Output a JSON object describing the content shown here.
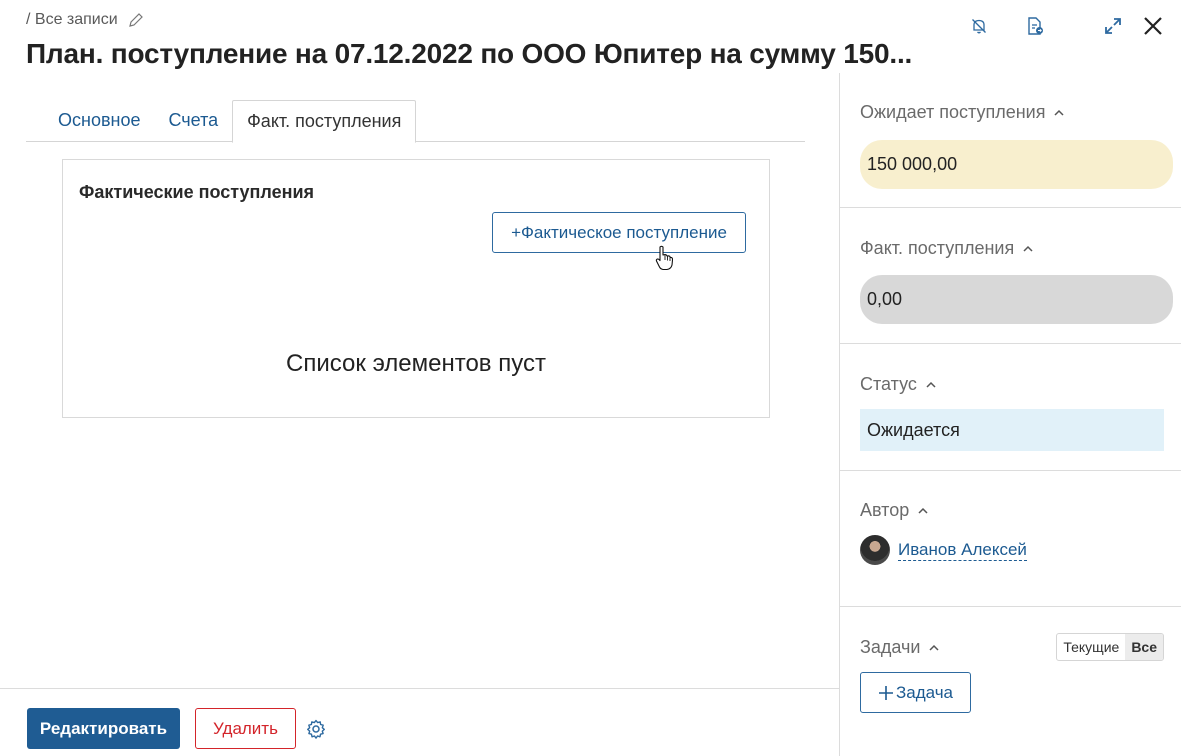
{
  "header": {
    "breadcrumb": "/ Все записи",
    "title": "План. поступление на 07.12.2022 по ООО Юпитер на сумму 150..."
  },
  "tabs": [
    {
      "label": "Основное"
    },
    {
      "label": "Счета"
    },
    {
      "label": "Факт. поступления"
    }
  ],
  "panel": {
    "title": "Фактические поступления",
    "add_button": "+Фактическое поступление",
    "empty_text": "Список элементов пуст"
  },
  "footer": {
    "edit_label": "Редактировать",
    "delete_label": "Удалить"
  },
  "sidebar": {
    "expected": {
      "label": "Ожидает поступления",
      "value": "150 000,00"
    },
    "actual": {
      "label": "Факт. поступления",
      "value": "0,00"
    },
    "status": {
      "label": "Статус",
      "value": "Ожидается"
    },
    "author": {
      "label": "Автор",
      "name": "Иванов Алексей"
    },
    "tasks": {
      "label": "Задачи",
      "toggle_current": "Текущие",
      "toggle_all": "Все",
      "add_button": "Задача"
    }
  },
  "colors": {
    "accent": "#1f5c93",
    "danger": "#d3242a",
    "expected_bg": "#f8efce",
    "actual_bg": "#d8d8d8",
    "status_bg": "#e1f1f9"
  }
}
